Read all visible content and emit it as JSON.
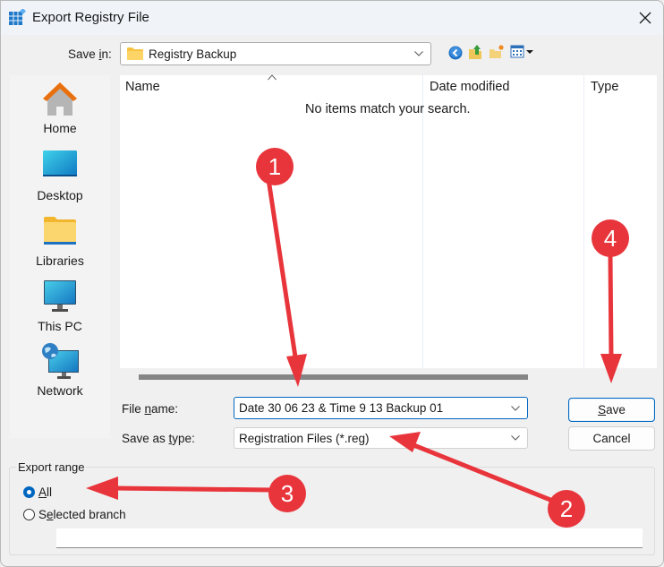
{
  "window": {
    "title": "Export Registry File",
    "icon": "registry-grid-icon",
    "close_icon": "close-icon"
  },
  "toolbar": {
    "save_in_label_pre": "Save ",
    "save_in_label_u": "i",
    "save_in_label_post": "n:",
    "save_in_value": "Registry Backup",
    "save_in_icon": "folder-icon",
    "nav_icons": [
      "back-icon",
      "up-folder-icon",
      "new-folder-icon",
      "view-menu-icon"
    ]
  },
  "places": [
    {
      "label": "Home",
      "icon": "home-icon"
    },
    {
      "label": "Desktop",
      "icon": "desktop-icon"
    },
    {
      "label": "Libraries",
      "icon": "libraries-icon"
    },
    {
      "label": "This PC",
      "icon": "this-pc-icon"
    },
    {
      "label": "Network",
      "icon": "network-icon"
    }
  ],
  "file_list": {
    "columns": [
      "Name",
      "Date modified",
      "Type"
    ],
    "empty_message": "No items match your search."
  },
  "form": {
    "file_name_label_pre": "File ",
    "file_name_label_u": "n",
    "file_name_label_post": "ame:",
    "file_name_value": "Date 30 06 23 & Time 9 13 Backup 01",
    "save_type_label_pre": "Save as ",
    "save_type_label_u": "t",
    "save_type_label_post": "ype:",
    "save_type_value": "Registration Files (*.reg)"
  },
  "buttons": {
    "save_u": "S",
    "save_rest": "ave",
    "cancel": "Cancel"
  },
  "export_range": {
    "title": "Export range",
    "options": [
      {
        "u": "A",
        "rest": "ll",
        "pre": "",
        "selected": true
      },
      {
        "pre": "S",
        "u": "e",
        "rest": "lected branch",
        "selected": false
      }
    ],
    "branch_value": ""
  },
  "annotations": {
    "color": "#e8353b",
    "markers": [
      "1",
      "2",
      "3",
      "4"
    ]
  }
}
